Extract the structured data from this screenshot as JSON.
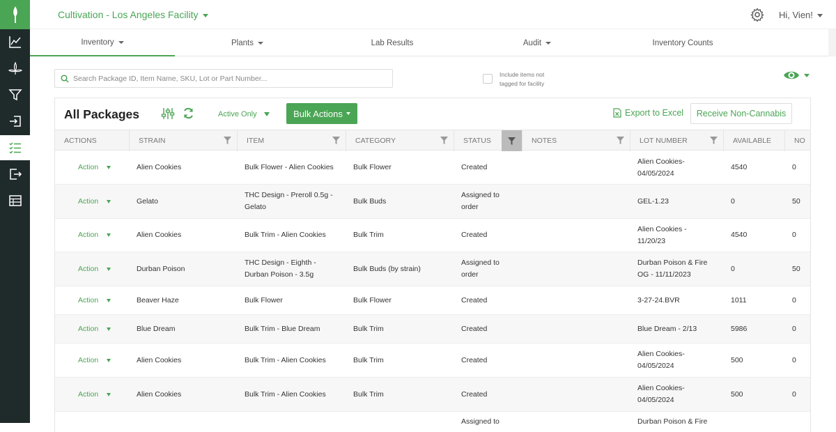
{
  "header": {
    "facility": "Cultivation - Los Angeles Facility",
    "greeting": "Hi, Vien!"
  },
  "nav": {
    "tabs": [
      {
        "label": "Inventory",
        "dropdown": true,
        "active": true
      },
      {
        "label": "Plants",
        "dropdown": true
      },
      {
        "label": "Lab Results",
        "dropdown": false
      },
      {
        "label": "Audit",
        "dropdown": true
      },
      {
        "label": "Inventory Counts",
        "dropdown": false
      }
    ]
  },
  "search": {
    "placeholder": "Search Package ID, Item Name, SKU, Lot or Part Number...",
    "value": ""
  },
  "include_untagged": {
    "label_line1": "Include items not",
    "label_line2": "tagged for facility",
    "checked": false
  },
  "panel": {
    "title": "All Packages",
    "filter_status": "Active Only",
    "bulk_actions": "Bulk Actions",
    "export": "Export to Excel",
    "receive": "Receive Non-Cannabis"
  },
  "table": {
    "columns": [
      "ACTIONS",
      "STRAIN",
      "ITEM",
      "CATEGORY",
      "STATUS",
      "NOTES",
      "LOT NUMBER",
      "AVAILABLE",
      "NO"
    ],
    "rows": [
      {
        "action": "Action",
        "strain": "Alien Cookies",
        "item": [
          "Bulk Flower - Alien Cookies"
        ],
        "category": "Bulk Flower",
        "status": [
          "Created"
        ],
        "notes": "",
        "lot": [
          "Alien Cookies-",
          "04/05/2024"
        ],
        "available": "4540",
        "no": "0"
      },
      {
        "action": "Action",
        "strain": "Gelato",
        "item": [
          "THC Design - Preroll 0.5g -",
          "Gelato"
        ],
        "category": "Bulk Buds",
        "status": [
          "Assigned to",
          "order"
        ],
        "notes": "",
        "lot": [
          "GEL-1.23"
        ],
        "available": "0",
        "no": "50"
      },
      {
        "action": "Action",
        "strain": "Alien Cookies",
        "item": [
          "Bulk Trim - Alien Cookies"
        ],
        "category": "Bulk Trim",
        "status": [
          "Created"
        ],
        "notes": "",
        "lot": [
          "Alien Cookies -",
          "11/20/23"
        ],
        "available": "4540",
        "no": "0"
      },
      {
        "action": "Action",
        "strain": "Durban Poison",
        "item": [
          "THC Design - Eighth -",
          "Durban Poison - 3.5g"
        ],
        "category": "Bulk Buds (by strain)",
        "status": [
          "Assigned to",
          "order"
        ],
        "notes": "",
        "lot": [
          "Durban Poison & Fire",
          "OG - 11/11/2023"
        ],
        "available": "0",
        "no": "50"
      },
      {
        "action": "Action",
        "strain": "Beaver Haze",
        "item": [
          "Bulk Flower"
        ],
        "category": "Bulk Flower",
        "status": [
          "Created"
        ],
        "notes": "",
        "lot": [
          "3-27-24.BVR"
        ],
        "available": "1011",
        "no": "0"
      },
      {
        "action": "Action",
        "strain": "Blue Dream",
        "item": [
          "Bulk Trim - Blue Dream"
        ],
        "category": "Bulk Trim",
        "status": [
          "Created"
        ],
        "notes": "",
        "lot": [
          "Blue Dream - 2/13"
        ],
        "available": "5986",
        "no": "0"
      },
      {
        "action": "Action",
        "strain": "Alien Cookies",
        "item": [
          "Bulk Trim - Alien Cookies"
        ],
        "category": "Bulk Trim",
        "status": [
          "Created"
        ],
        "notes": "",
        "lot": [
          "Alien Cookies-",
          "04/05/2024"
        ],
        "available": "500",
        "no": "0"
      },
      {
        "action": "Action",
        "strain": "Alien Cookies",
        "item": [
          "Bulk Trim - Alien Cookies"
        ],
        "category": "Bulk Trim",
        "status": [
          "Created"
        ],
        "notes": "",
        "lot": [
          "Alien Cookies-",
          "04/05/2024"
        ],
        "available": "500",
        "no": "0"
      },
      {
        "action": "",
        "strain": "",
        "item": [
          ""
        ],
        "category": "",
        "status": [
          "Assigned to"
        ],
        "notes": "",
        "lot": [
          "Durban Poison & Fire"
        ],
        "available": "",
        "no": ""
      }
    ]
  },
  "colors": {
    "accent": "#4aa554",
    "sidebar": "#1f2a2b"
  },
  "icons": {
    "sidebar": [
      "leaf-logo-icon",
      "line-chart-icon",
      "cannabis-icon",
      "funnel-icon",
      "sign-in-icon",
      "checklist-icon",
      "sign-out-icon",
      "table-icon"
    ]
  }
}
